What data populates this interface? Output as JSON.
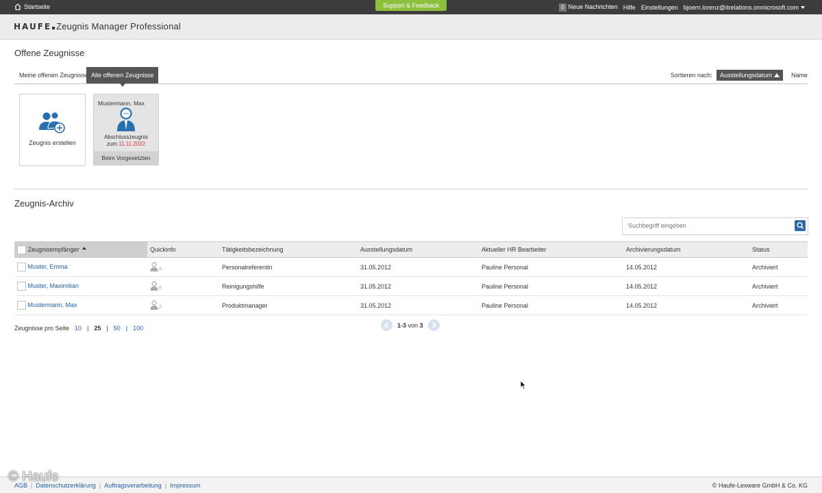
{
  "topbar": {
    "home_label": "Startseite",
    "support_label": "Support & Feedback",
    "messages_count": "0",
    "messages_label": "Neue Nachrichten",
    "help_label": "Hilfe",
    "settings_label": "Einstellungen",
    "user_email": "bjoern.lorenz@itrelations.onmicrosoft.com"
  },
  "header": {
    "brand": "HAUFE",
    "app_name": "Zeugnis Manager Professional"
  },
  "open_section": {
    "title": "Offene Zeugnisse",
    "tabs": [
      {
        "label": "Meine offenen Zeugnisse",
        "active": false
      },
      {
        "label": "Alle offenen Zeugnisse",
        "active": true
      }
    ],
    "sort_label": "Sortieren nach:",
    "sort_active": "Ausstellungsdatum",
    "sort_other": "Name",
    "create_card_label": "Zeugnis erstellen",
    "person_card": {
      "name": "Mustermann, Max",
      "type": "Abschlusszeugnis",
      "date_prefix": "zum",
      "date": "11.11.2022",
      "status": "Beim Vorgesetzten"
    }
  },
  "archive": {
    "title": "Zeugnis-Archiv",
    "search_placeholder": "Suchbegriff eingeben",
    "columns": [
      "Zeugnisempfänger",
      "Quickinfo",
      "Tätigkeitsbezeichnung",
      "Ausstellungsdatum",
      "Aktueller HR Bearbeiter",
      "Archivierungsdatum",
      "Status"
    ],
    "rows": [
      {
        "name": "Muster, Emma",
        "quick": "A",
        "job": "Personalreferentin",
        "issued": "31.05.2012",
        "hr": "Pauline Personal",
        "archived": "14.05.2012",
        "status": "Archiviert"
      },
      {
        "name": "Muster, Maximilian",
        "quick": "E",
        "job": "Reinigungshilfe",
        "issued": "31.05.2012",
        "hr": "Pauline Personal",
        "archived": "14.05.2012",
        "status": "Archiviert"
      },
      {
        "name": "Mustermann, Max",
        "quick": "Z",
        "job": "Produktmanager",
        "issued": "31.05.2012",
        "hr": "Pauline Personal",
        "archived": "14.05.2012",
        "status": "Archiviert"
      }
    ],
    "per_page_label": "Zeugnisse pro Seite",
    "per_page_options": [
      "10",
      "25",
      "50",
      "100"
    ],
    "per_page_selected": "25",
    "pager_range": "1-3",
    "pager_of": "von",
    "pager_total": "3"
  },
  "footer": {
    "links": [
      "AGB",
      "Datenschutzerklärung",
      "Auftragsverarbeitung",
      "Impressum"
    ],
    "copyright": "© Haufe-Lexware GmbH & Co. KG",
    "watermark": "© Haufe"
  },
  "colors": {
    "topbar": "#3c3c3c",
    "support": "#8dbf3f",
    "link": "#1f5fa6",
    "accent": "#2d6aa8",
    "date_red": "#dd3333"
  }
}
